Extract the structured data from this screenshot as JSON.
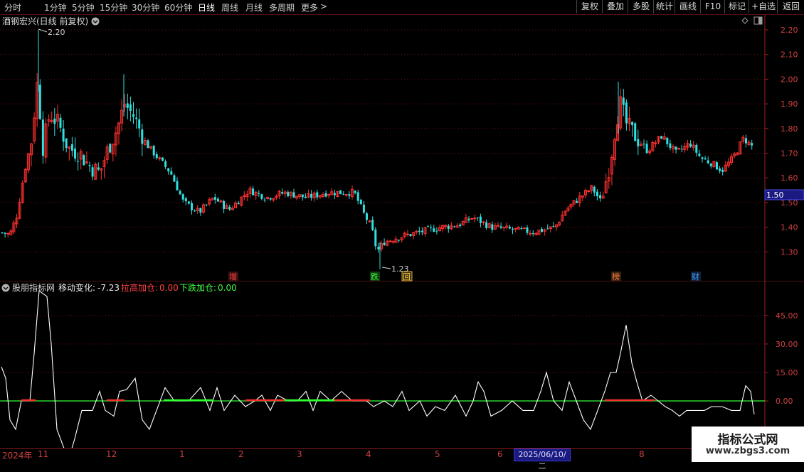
{
  "toolbar": {
    "periods": [
      "分时",
      "1分钟",
      "5分钟",
      "15分钟",
      "30分钟",
      "60分钟",
      "日线",
      "周线",
      "月线",
      "多周期",
      "更多"
    ],
    "active_period": "日线",
    "more_arrow": ">",
    "right_buttons": [
      "复权",
      "叠加",
      "多股",
      "统计",
      "画线",
      "F10",
      "标记",
      "+自选",
      "返回"
    ]
  },
  "main_chart": {
    "title": "酒钢宏兴(日线 前复权)",
    "price_ticks": [
      "2.20",
      "2.10",
      "2.00",
      "1.90",
      "1.80",
      "1.70",
      "1.60",
      "1.50",
      "1.40",
      "1.30"
    ],
    "current_price": "1.50",
    "high_label": "2.20",
    "low_label": "1.23",
    "event_markers": [
      {
        "text": "增",
        "color": "#ff4040"
      },
      {
        "text": "跌",
        "color": "#40ff40"
      },
      {
        "text": "回",
        "color": "#ffcc40"
      },
      {
        "text": "榜",
        "color": "#ff8040"
      },
      {
        "text": "财",
        "color": "#40a0ff"
      }
    ]
  },
  "indicator": {
    "name": "股朋指标网",
    "line1_label": "移动变化:",
    "line1_value": "-7.23",
    "line2_label": "拉高加仓:",
    "line2_value": "0.00",
    "line3_label": "下跌加仓:",
    "line3_value": "0.00",
    "y_ticks": [
      "45.00",
      "30.00",
      "15.00",
      "0.00"
    ]
  },
  "date_axis": {
    "year": "2024年",
    "months": [
      "11",
      "12",
      "1",
      "2",
      "3",
      "4",
      "5",
      "6",
      "8"
    ],
    "cursor_date": "2025/06/10/二"
  },
  "watermark": {
    "line1": "指标公式网",
    "line2": "www.zbgs3.com"
  },
  "colors": {
    "up": "#ff3030",
    "down": "#30e0e0",
    "axis": "#d04040",
    "grid": "#6a1010",
    "osc_line": "#ffffff",
    "zero_line": "#30ff30"
  }
}
